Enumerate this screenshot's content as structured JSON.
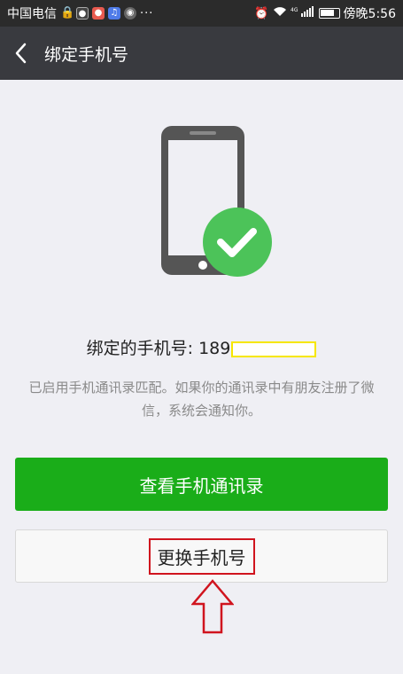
{
  "status_bar": {
    "carrier": "中国电信",
    "dots": "···",
    "network": "4G",
    "time": "傍晚5:56"
  },
  "header": {
    "title": "绑定手机号"
  },
  "main": {
    "bound_label": "绑定的手机号: ",
    "bound_number_visible": "189",
    "description": "已启用手机通讯录匹配。如果你的通讯录中有朋友注册了微信，系统会通知你。",
    "view_contacts_label": "查看手机通讯录",
    "change_number_label": "更换手机号"
  },
  "colors": {
    "accent_green": "#1aad19",
    "check_green": "#4cc359",
    "title_bar": "#393a3f",
    "annotation_red": "#d0141e"
  },
  "icons": [
    "back-arrow-icon",
    "phone-icon",
    "checkmark-icon",
    "up-arrow-annotation"
  ]
}
